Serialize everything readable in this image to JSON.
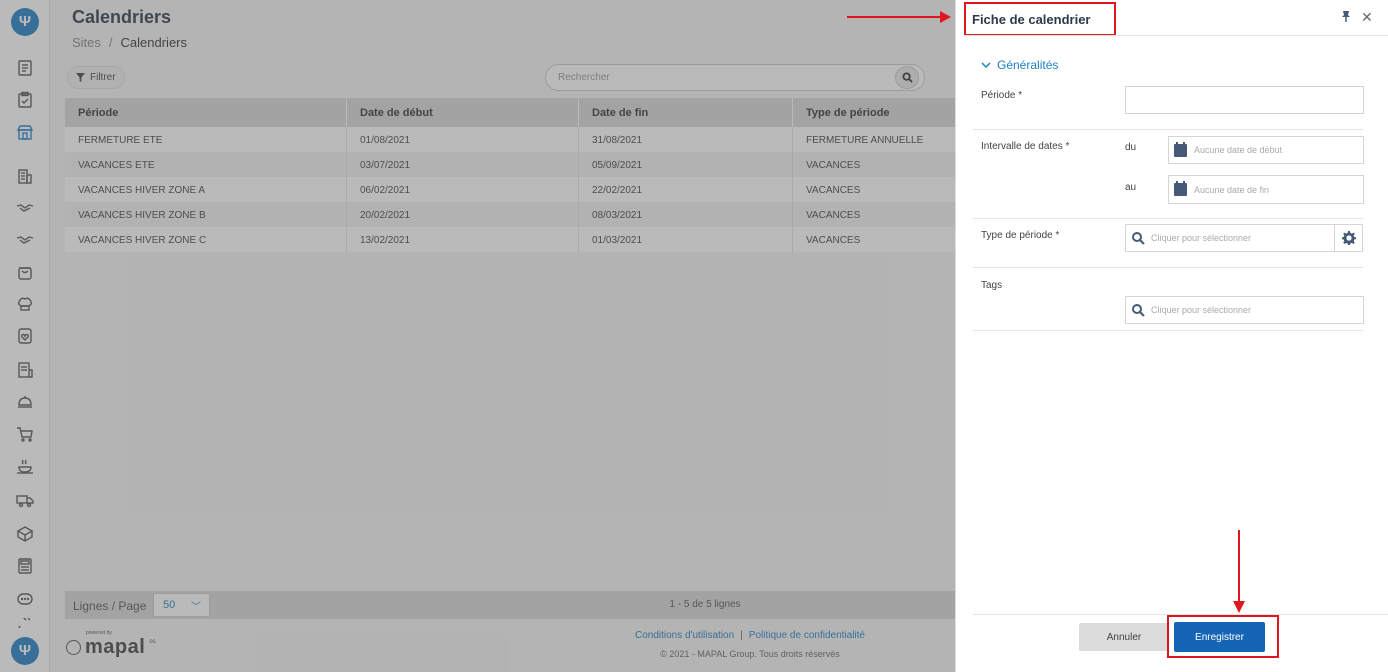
{
  "page": {
    "title": "Calendriers",
    "breadcrumb": [
      "Sites",
      "Calendriers"
    ],
    "breadcrumb_separator": "/"
  },
  "toolbar": {
    "filter_label": "Filtrer",
    "search_placeholder": "Rechercher"
  },
  "table": {
    "columns": [
      "Période",
      "Date de début",
      "Date de fin",
      "Type de période"
    ],
    "rows": [
      [
        "FERMETURE ETE",
        "01/08/2021",
        "31/08/2021",
        "FERMETURE ANNUELLE"
      ],
      [
        "VACANCES ETE",
        "03/07/2021",
        "05/09/2021",
        "VACANCES"
      ],
      [
        "VACANCES HIVER ZONE A",
        "06/02/2021",
        "22/02/2021",
        "VACANCES"
      ],
      [
        "VACANCES HIVER ZONE B",
        "20/02/2021",
        "08/03/2021",
        "VACANCES"
      ],
      [
        "VACANCES HIVER ZONE C",
        "13/02/2021",
        "01/03/2021",
        "VACANCES"
      ]
    ]
  },
  "pager": {
    "rows_per_page_label": "Lignes / Page",
    "rows_per_page_value": "50",
    "count_text": "1 - 5 de 5 lignes"
  },
  "footer": {
    "powered_by": "powered by",
    "brand": "mapal",
    "brand_suffix": "os",
    "terms_link": "Conditions d'utilisation",
    "link_separator": "|",
    "privacy_link": "Politique de confidentialité",
    "copyright": "© 2021 - MAPAL Group. Tous droits réservés"
  },
  "panel": {
    "title": "Fiche de calendrier",
    "section_title": "Généralités",
    "fields": {
      "periode_label": "Période *",
      "periode_value": "",
      "interval_label": "Intervalle de dates *",
      "from_label": "du",
      "from_placeholder": "Aucune date de début",
      "to_label": "au",
      "to_placeholder": "Aucune date de fin",
      "type_label": "Type de période *",
      "type_placeholder": "Cliquer pour sélectionner",
      "tags_label": "Tags",
      "tags_placeholder": "Cliquer pour sélectionner"
    },
    "cancel_label": "Annuler",
    "save_label": "Enregistrer"
  },
  "colors": {
    "accent": "#1f7fc4",
    "primary_button": "#1565b6",
    "annotation_red": "#e0161e"
  },
  "icons": [
    "notes-icon",
    "clipboard-icon",
    "store-icon",
    "building-icon",
    "handshake-icon",
    "handshake-icon",
    "bag-icon",
    "chef-hat-icon",
    "menu-heart-icon",
    "invoice-icon",
    "cloche-icon",
    "cart-icon",
    "cooking-icon",
    "truck-icon",
    "box-icon",
    "calculator-icon",
    "chat-icon",
    "plug-icon"
  ]
}
